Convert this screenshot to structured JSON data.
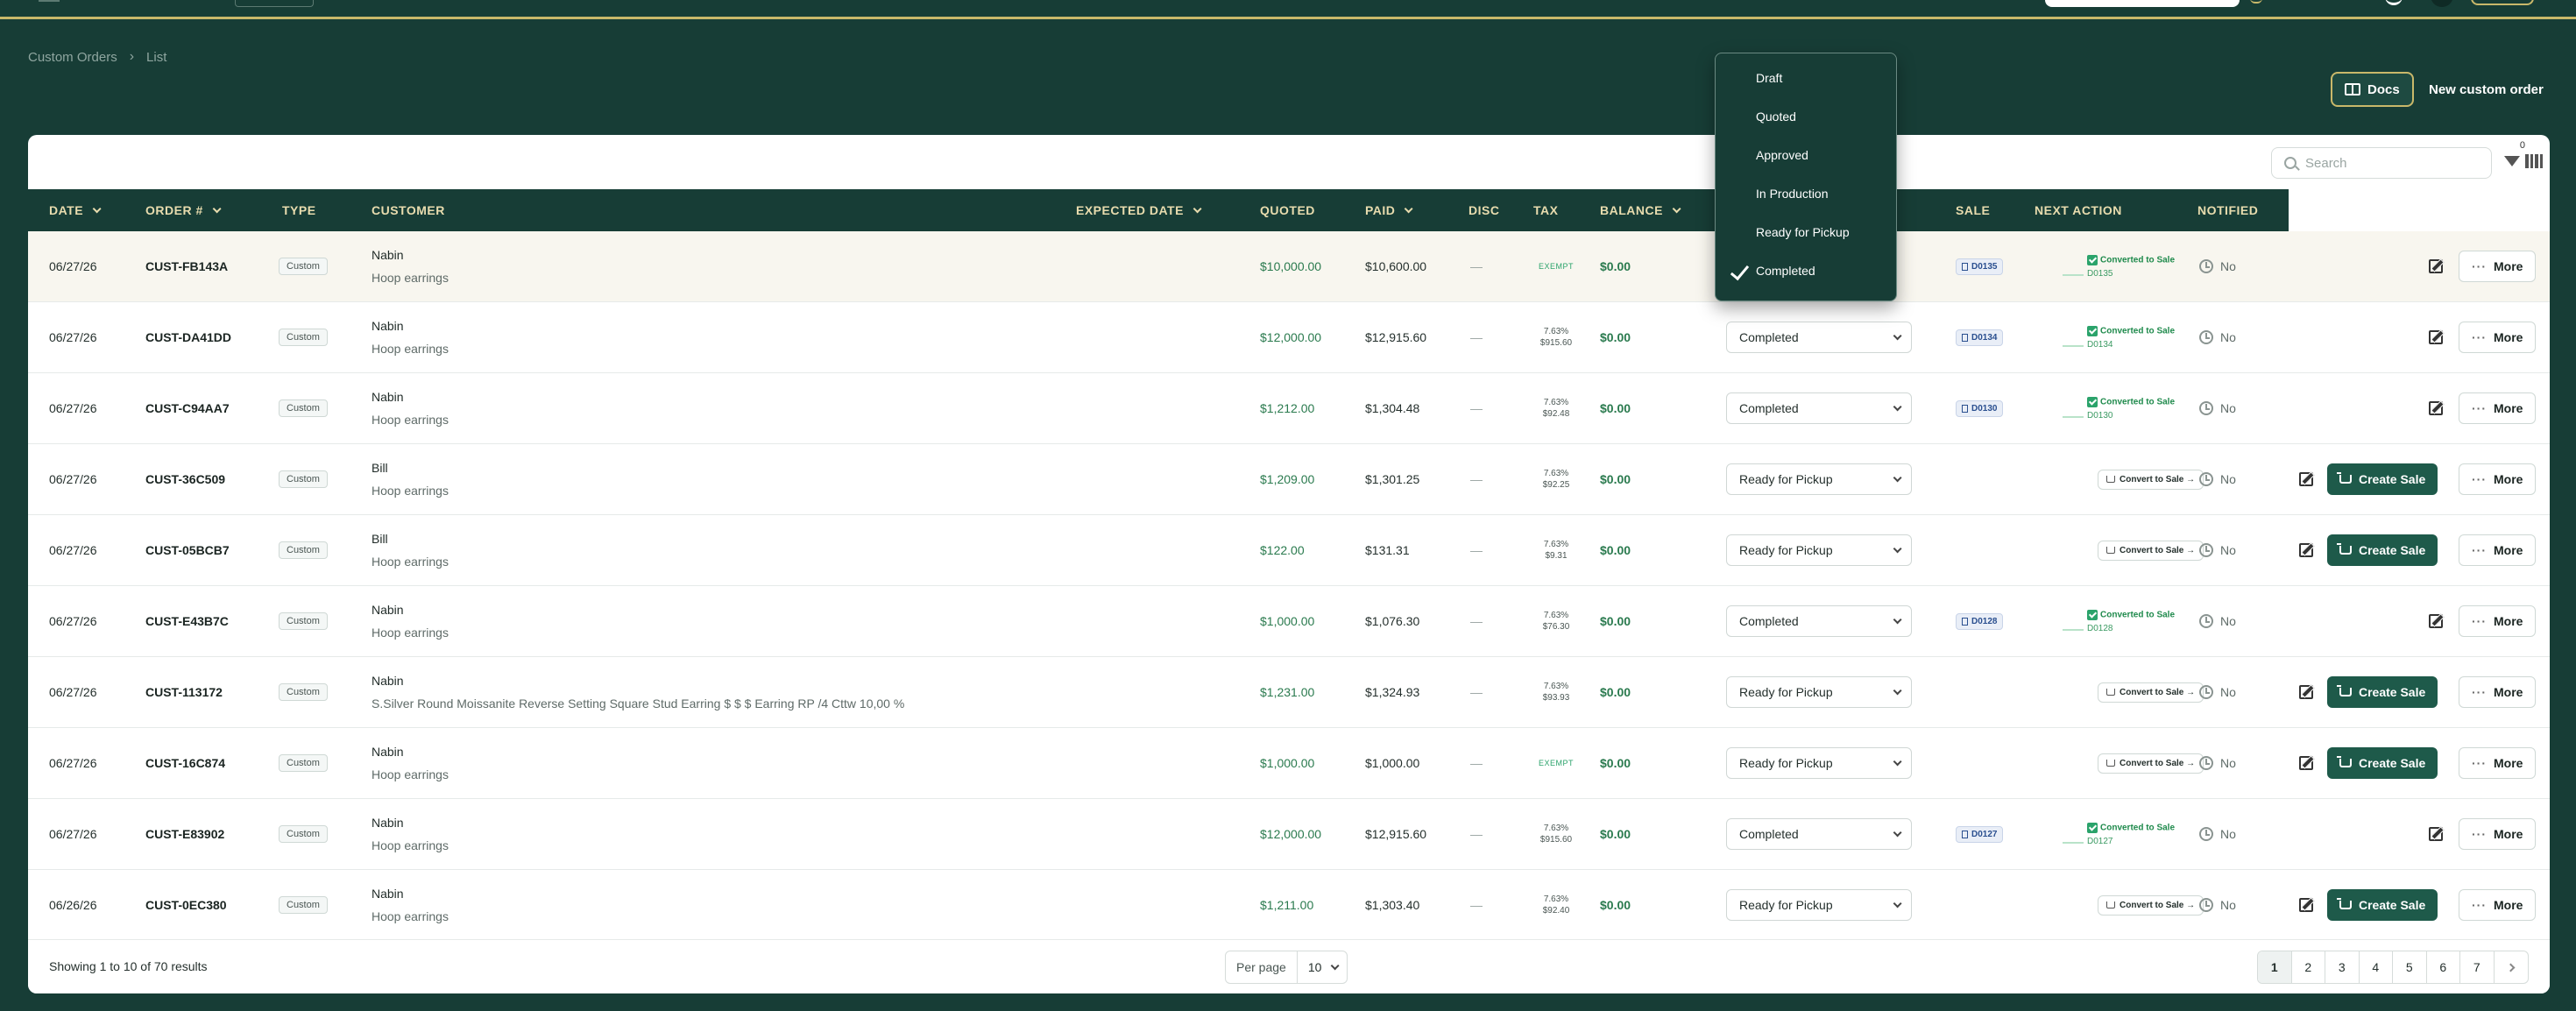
{
  "breadcrumb": {
    "root": "Custom Orders",
    "current": "List"
  },
  "header": {
    "docs_label": "Docs",
    "new_order_label": "New custom order"
  },
  "toolbar": {
    "search_placeholder": "Search",
    "filter_count": "0"
  },
  "columns": {
    "date": "DATE",
    "order": "ORDER #",
    "type": "TYPE",
    "customer": "CUSTOMER",
    "expected": "EXPECTED DATE",
    "quoted": "QUOTED",
    "paid": "PAID",
    "disc": "DISC",
    "tax": "TAX",
    "balance": "BALANCE",
    "sale": "SALE",
    "next_action": "NEXT ACTION",
    "notified": "NOTIFIED"
  },
  "rows": [
    {
      "date": "06/27/26",
      "order": "CUST-FB143A",
      "type": "Custom",
      "customer": "Nabin",
      "desc": "Hoop earrings",
      "quoted": "$10,000.00",
      "paid": "$10,600.00",
      "disc": "—",
      "tax_rate": "",
      "tax_amt": "",
      "tax_exempt": "EXEMPT",
      "balance": "$0.00",
      "status": "Completed",
      "sale": "D0135",
      "conv_label": "Converted to Sale",
      "conv_link": "D0135",
      "notified": "No",
      "more": "More",
      "create": ""
    },
    {
      "date": "06/27/26",
      "order": "CUST-DA41DD",
      "type": "Custom",
      "customer": "Nabin",
      "desc": "Hoop earrings",
      "quoted": "$12,000.00",
      "paid": "$12,915.60",
      "disc": "—",
      "tax_rate": "7.63%",
      "tax_amt": "$915.60",
      "tax_exempt": "",
      "balance": "$0.00",
      "status": "Completed",
      "sale": "D0134",
      "conv_label": "Converted to Sale",
      "conv_link": "D0134",
      "notified": "No",
      "more": "More",
      "create": ""
    },
    {
      "date": "06/27/26",
      "order": "CUST-C94AA7",
      "type": "Custom",
      "customer": "Nabin",
      "desc": "Hoop earrings",
      "quoted": "$1,212.00",
      "paid": "$1,304.48",
      "disc": "—",
      "tax_rate": "7.63%",
      "tax_amt": "$92.48",
      "tax_exempt": "",
      "balance": "$0.00",
      "status": "Completed",
      "sale": "D0130",
      "conv_label": "Converted to Sale",
      "conv_link": "D0130",
      "notified": "No",
      "more": "More",
      "create": ""
    },
    {
      "date": "06/27/26",
      "order": "CUST-36C509",
      "type": "Custom",
      "customer": "Bill",
      "desc": "Hoop earrings",
      "quoted": "$1,209.00",
      "paid": "$1,301.25",
      "disc": "—",
      "tax_rate": "7.63%",
      "tax_amt": "$92.25",
      "tax_exempt": "",
      "balance": "$0.00",
      "status": "Ready for Pickup",
      "sale": "",
      "convert_btn": "Convert to Sale →",
      "notified": "No",
      "more": "More",
      "create": "Create Sale"
    },
    {
      "date": "06/27/26",
      "order": "CUST-05BCB7",
      "type": "Custom",
      "customer": "Bill",
      "desc": "Hoop earrings",
      "quoted": "$122.00",
      "paid": "$131.31",
      "disc": "—",
      "tax_rate": "7.63%",
      "tax_amt": "$9.31",
      "tax_exempt": "",
      "balance": "$0.00",
      "status": "Ready for Pickup",
      "sale": "",
      "convert_btn": "Convert to Sale →",
      "notified": "No",
      "more": "More",
      "create": "Create Sale"
    },
    {
      "date": "06/27/26",
      "order": "CUST-E43B7C",
      "type": "Custom",
      "customer": "Nabin",
      "desc": "Hoop earrings",
      "quoted": "$1,000.00",
      "paid": "$1,076.30",
      "disc": "—",
      "tax_rate": "7.63%",
      "tax_amt": "$76.30",
      "tax_exempt": "",
      "balance": "$0.00",
      "status": "Completed",
      "sale": "D0128",
      "conv_label": "Converted to Sale",
      "conv_link": "D0128",
      "notified": "No",
      "more": "More",
      "create": ""
    },
    {
      "date": "06/27/26",
      "order": "CUST-113172",
      "type": "Custom",
      "customer": "Nabin",
      "desc": "S.Silver Round Moissanite Reverse Setting Square Stud Earring $ $ $ Earring RP /4 Cttw 10,00 %",
      "quoted": "$1,231.00",
      "paid": "$1,324.93",
      "disc": "—",
      "tax_rate": "7.63%",
      "tax_amt": "$93.93",
      "tax_exempt": "",
      "balance": "$0.00",
      "status": "Ready for Pickup",
      "sale": "",
      "convert_btn": "Convert to Sale →",
      "notified": "No",
      "more": "More",
      "create": "Create Sale"
    },
    {
      "date": "06/27/26",
      "order": "CUST-16C874",
      "type": "Custom",
      "customer": "Nabin",
      "desc": "Hoop earrings",
      "quoted": "$1,000.00",
      "paid": "$1,000.00",
      "disc": "—",
      "tax_rate": "",
      "tax_amt": "",
      "tax_exempt": "EXEMPT",
      "balance": "$0.00",
      "status": "Ready for Pickup",
      "sale": "",
      "convert_btn": "Convert to Sale →",
      "notified": "No",
      "more": "More",
      "create": "Create Sale"
    },
    {
      "date": "06/27/26",
      "order": "CUST-E83902",
      "type": "Custom",
      "customer": "Nabin",
      "desc": "Hoop earrings",
      "quoted": "$12,000.00",
      "paid": "$12,915.60",
      "disc": "—",
      "tax_rate": "7.63%",
      "tax_amt": "$915.60",
      "tax_exempt": "",
      "balance": "$0.00",
      "status": "Completed",
      "sale": "D0127",
      "conv_label": "Converted to Sale",
      "conv_link": "D0127",
      "notified": "No",
      "more": "More",
      "create": ""
    },
    {
      "date": "06/26/26",
      "order": "CUST-0EC380",
      "type": "Custom",
      "customer": "Nabin",
      "desc": "Hoop earrings",
      "quoted": "$1,211.00",
      "paid": "$1,303.40",
      "disc": "—",
      "tax_rate": "7.63%",
      "tax_amt": "$92.40",
      "tax_exempt": "",
      "balance": "$0.00",
      "status": "Ready for Pickup",
      "sale": "",
      "convert_btn": "Convert to Sale →",
      "notified": "No",
      "more": "More",
      "create": "Create Sale"
    }
  ],
  "footer": {
    "showing": "Showing 1 to 10 of 70 results",
    "per_page_label": "Per page",
    "per_page_value": "10",
    "pages": [
      "1",
      "2",
      "3",
      "4",
      "5",
      "6",
      "7"
    ]
  },
  "status_menu": {
    "options": [
      "Draft",
      "Quoted",
      "Approved",
      "In Production",
      "Ready for Pickup",
      "Completed"
    ],
    "selected": "Completed"
  },
  "colors": {
    "brand": "#173d36",
    "accent": "#c9b86a",
    "create_sale": "#1e5a4a",
    "positive": "#2a7a4e"
  }
}
